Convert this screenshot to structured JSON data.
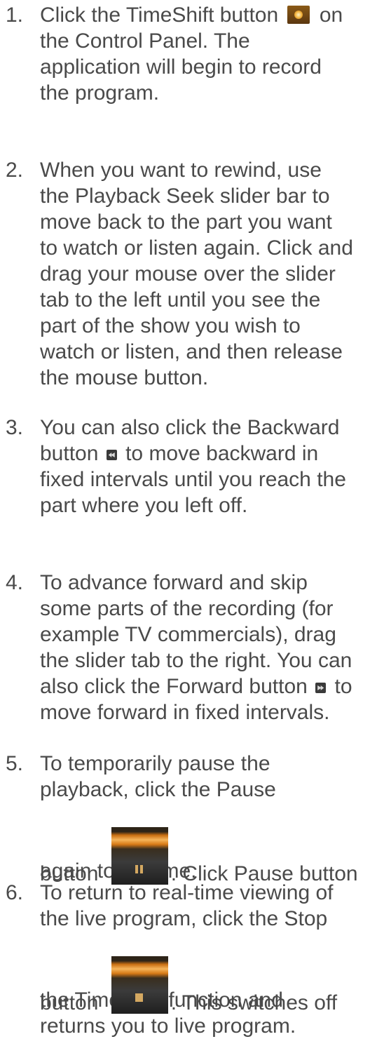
{
  "steps": [
    {
      "number": "1.",
      "lines": [
        "Click the TimeShift button",
        "on",
        "the Control Panel. The",
        "application will begin to record",
        "the program."
      ],
      "icon": "timeshift-icon"
    },
    {
      "number": "2.",
      "lines": [
        "When you want to rewind, use",
        "the Playback Seek slider bar to",
        "move back to the part you want",
        "to watch or listen again. Click and",
        "drag your mouse over the slider",
        "tab to the left until you see the",
        "part of the show you wish to",
        "watch or listen, and then release",
        "the mouse button."
      ]
    },
    {
      "number": "3.",
      "lines": [
        "You can also click the Backward",
        "button",
        "to move backward in",
        "fixed intervals until you reach the",
        "part where you left off."
      ],
      "icon": "backward-icon"
    },
    {
      "number": "4.",
      "lines": [
        "To advance forward and skip",
        "some parts of the recording (for",
        "example TV commercials), drag",
        "the slider tab to the right. You can",
        "also click the Forward button",
        "to",
        "move forward in fixed intervals."
      ],
      "icon": "forward-icon"
    },
    {
      "number": "5.",
      "lines": [
        "To temporarily pause the",
        "playback, click the Pause",
        "button",
        ". Click Pause button",
        "again to resume."
      ],
      "icon": "pause-icon"
    },
    {
      "number": "6.",
      "lines": [
        "To return to real-time viewing of",
        "the live program, click the Stop",
        "button",
        ". This switches off",
        "the TimeShift function and",
        "returns you to live program."
      ],
      "icon": "stop-icon"
    }
  ]
}
